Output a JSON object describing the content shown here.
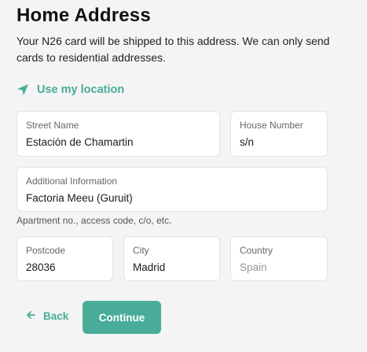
{
  "header": {
    "title": "Home Address",
    "subtitle": "Your N26 card will be shipped to this address. We can only send cards to residential addresses."
  },
  "location": {
    "label": "Use my location",
    "icon": "navigation-arrow-icon"
  },
  "form": {
    "street_name": {
      "label": "Street Name",
      "value": "Estación de Chamartin"
    },
    "house_number": {
      "label": "House Number",
      "value": "s/n"
    },
    "additional_info": {
      "label": "Additional Information",
      "value": "Factoria Meeu (Guruit)",
      "helper": "Apartment no., access code, c/o, etc."
    },
    "postcode": {
      "label": "Postcode",
      "value": "28036"
    },
    "city": {
      "label": "City",
      "value": "Madrid"
    },
    "country": {
      "label": "Country",
      "value": "Spain"
    }
  },
  "actions": {
    "back_label": "Back",
    "continue_label": "Continue"
  },
  "colors": {
    "accent": "#48ac98",
    "background": "#f4f4f4",
    "field_background": "#ffffff",
    "border": "#e3e3e3"
  }
}
